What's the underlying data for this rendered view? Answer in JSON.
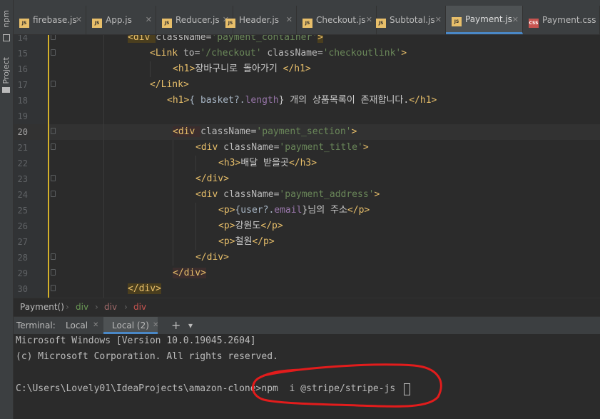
{
  "tool_window": {
    "npm_label": "npm",
    "project_label": "Project"
  },
  "tabs": [
    {
      "label": "firebase.js",
      "type": "js"
    },
    {
      "label": "App.js",
      "type": "js"
    },
    {
      "label": "Reducer.js",
      "type": "js"
    },
    {
      "label": "Header.js",
      "type": "js"
    },
    {
      "label": "Checkout.js",
      "type": "js"
    },
    {
      "label": "Subtotal.js",
      "type": "js"
    },
    {
      "label": "Payment.js",
      "type": "js",
      "active": true
    },
    {
      "label": "Payment.css",
      "type": "css"
    }
  ],
  "file_icon_labels": {
    "js": "JS",
    "css": "CSS"
  },
  "editor": {
    "line_numbers": [
      "14",
      "15",
      "16",
      "17",
      "18",
      "19",
      "20",
      "21",
      "22",
      "23",
      "24",
      "25",
      "26",
      "27",
      "28",
      "29",
      "30"
    ],
    "current_line": "20",
    "code": {
      "l14_open": "<div ",
      "l14_attr": "className=",
      "l14_str": "'payment_container'",
      "l14_close": ">",
      "l15_open": "<Link ",
      "l15_attr1": "to=",
      "l15_str1": "'/checkout' ",
      "l15_attr2": "className=",
      "l15_str2": "'checkoutlink'",
      "l15_close": ">",
      "l16_open": "<h1>",
      "l16_text": "장바구니로 돌아가기 ",
      "l16_close": "</h1>",
      "l17_tag": "</Link>",
      "l18_open": "<h1>",
      "l18_text1": "{ basket?.",
      "l18_prop": "length",
      "l18_text2": "} 개의 상품목록이 존재합니다.",
      "l18_close": "</h1>",
      "l20_open": "<div ",
      "l20_attr": "className=",
      "l20_str": "'payment_section'",
      "l20_close": ">",
      "l21_open": "<div ",
      "l21_attr": "className=",
      "l21_str": "'payment_title'",
      "l21_close": ">",
      "l22_open": "<h3>",
      "l22_text": "배달 받을곳",
      "l22_close": "</h3>",
      "l23_tag": "</div>",
      "l24_open": "<div ",
      "l24_attr": "className=",
      "l24_str": "'payment_address'",
      "l24_close": ">",
      "l25_open": "<p>",
      "l25_text1": "{user?.",
      "l25_prop": "email",
      "l25_text2": "}님의 주소",
      "l25_close": "</p>",
      "l26_open": "<p>",
      "l26_text": "강원도",
      "l26_close": "</p>",
      "l27_open": "<p>",
      "l27_text": "철원",
      "l27_close": "</p>",
      "l28_tag": "</div>",
      "l29_tag": "</div>",
      "l30_tag": "</div>"
    }
  },
  "breadcrumb": [
    "Payment()",
    "div",
    "div",
    "div"
  ],
  "terminal_bar": {
    "label": "Terminal:",
    "tabs": [
      "Local",
      "Local (2)"
    ],
    "active_tab": "Local (2)",
    "add_symbol": "+",
    "dropdown_symbol": "▾"
  },
  "terminal": {
    "lines": [
      "Microsoft Windows [Version 10.0.19045.2604]",
      "(c) Microsoft Corporation. All rights reserved."
    ],
    "prompt": "C:\\Users\\Lovely01\\IdeaProjects\\amazon-clone>",
    "command": "npm  i @stripe/stripe-js"
  },
  "colors": {
    "editor_bg": "#2b2b2b",
    "tag": "#e8bf6a",
    "string": "#6a8759",
    "accent": "#4a88c7",
    "annotation": "#e21c1c"
  }
}
